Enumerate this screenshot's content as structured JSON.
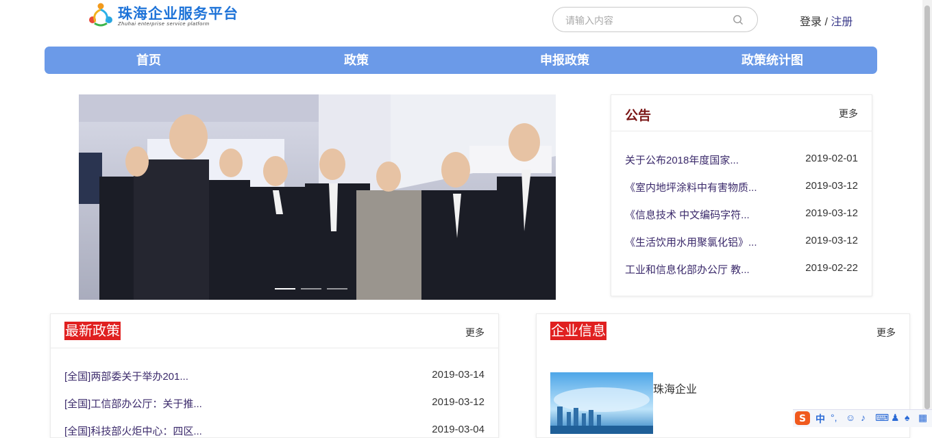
{
  "logo": {
    "title": "珠海企业服务平台",
    "subtitle": "Zhuhai enterprise service platform"
  },
  "search": {
    "placeholder": "请输入内容"
  },
  "auth": {
    "login": "登录",
    "sep": " / ",
    "register": "注册"
  },
  "nav": [
    "首页",
    "政策",
    "申报政策",
    "政策统计图"
  ],
  "notice": {
    "title": "公告",
    "more": "更多",
    "items": [
      {
        "title": "关于公布2018年度国家...",
        "date": "2019-02-01"
      },
      {
        "title": "《室内地坪涂料中有害物质...",
        "date": "2019-03-12"
      },
      {
        "title": "《信息技术 中文编码字符...",
        "date": "2019-03-12"
      },
      {
        "title": "《生活饮用水用聚氯化铝》...",
        "date": "2019-03-12"
      },
      {
        "title": "工业和信息化部办公厅 教...",
        "date": "2019-02-22"
      }
    ]
  },
  "latest_policy": {
    "title": "最新政策",
    "more": "更多",
    "items": [
      {
        "title": "[全国]两部委关于举办201...",
        "date": "2019-03-14"
      },
      {
        "title": "[全国]工信部办公厅：关于推...",
        "date": "2019-03-12"
      },
      {
        "title": "[全国]科技部火炬中心：四区...",
        "date": "2019-03-04"
      }
    ]
  },
  "company": {
    "title": "企业信息",
    "more": "更多",
    "name": "珠海企业"
  },
  "banner": {
    "slides": 3,
    "active": 0
  },
  "ime": {
    "label": "中"
  },
  "colors": {
    "nav": "#6b9ae8",
    "accent_red": "#e02020",
    "notice_title": "#7a1515",
    "link": "#3b2a6b"
  }
}
